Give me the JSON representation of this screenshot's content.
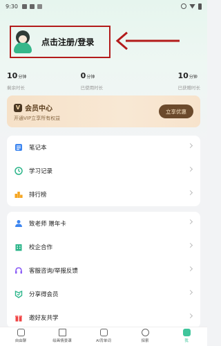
{
  "status_bar": {
    "time": "9:30"
  },
  "header": {
    "login_text": "点击注册/登录"
  },
  "stats": [
    {
      "value": "10",
      "unit": "分钟",
      "label": "剩余时长"
    },
    {
      "value": "0",
      "unit": "分钟",
      "label": "已使用时长"
    },
    {
      "value": "10",
      "unit": "分钟",
      "label": "已获赠时长"
    }
  ],
  "vip": {
    "badge": "V",
    "title": "会员中心",
    "subtitle": "开通VIP立享所有权益",
    "button": "立享优惠"
  },
  "menu_group_1": [
    {
      "label": "笔记本",
      "icon": "notebook-icon"
    },
    {
      "label": "学习记录",
      "icon": "clock-icon"
    },
    {
      "label": "排行榜",
      "icon": "ranking-icon"
    }
  ],
  "menu_group_2": [
    {
      "label": "致老师 赠年卡",
      "icon": "teacher-icon"
    },
    {
      "label": "校企合作",
      "icon": "building-icon"
    },
    {
      "label": "客服咨询/举报反馈",
      "icon": "headset-icon"
    },
    {
      "label": "分享得会员",
      "icon": "share-icon"
    },
    {
      "label": "邀好友共学",
      "icon": "invite-icon"
    }
  ],
  "bottom_nav": [
    {
      "label": "自由聊",
      "icon": "chat-icon"
    },
    {
      "label": "绘画情景课",
      "icon": "graduation-cap-icon"
    },
    {
      "label": "AI背单词",
      "icon": "flashcard-icon"
    },
    {
      "label": "探索",
      "icon": "planet-icon"
    },
    {
      "label": "我",
      "icon": "profile-icon"
    }
  ],
  "colors": {
    "accent": "#3fc59b",
    "annotation": "#b31b1b",
    "vip_button": "#6b4a2c"
  }
}
